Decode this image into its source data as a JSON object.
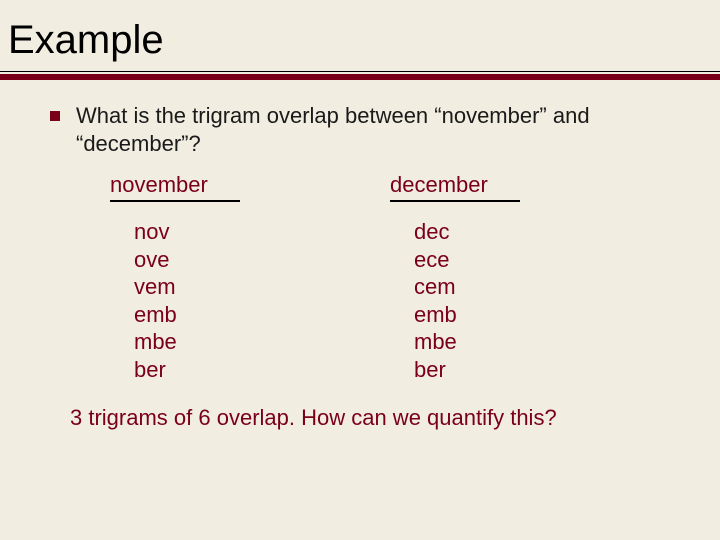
{
  "title": "Example",
  "bullet": "What is the trigram overlap between “november” and “december”?",
  "left": {
    "header": "november",
    "trigrams": [
      "nov",
      "ove",
      "vem",
      "emb",
      "mbe",
      "ber"
    ]
  },
  "right": {
    "header": "december",
    "trigrams": [
      "dec",
      "ece",
      "cem",
      "emb",
      "mbe",
      "ber"
    ]
  },
  "footer": "3 trigrams of 6 overlap.  How can we quantify this?"
}
